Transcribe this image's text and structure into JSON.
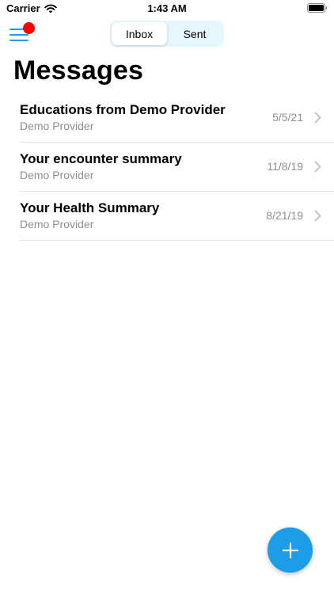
{
  "status_bar": {
    "carrier": "Carrier",
    "time": "1:43 AM"
  },
  "header": {
    "menu_icon": "hamburger-menu-icon",
    "has_notification": true,
    "tabs": [
      {
        "label": "Inbox",
        "selected": true
      },
      {
        "label": "Sent",
        "selected": false
      }
    ]
  },
  "page": {
    "title": "Messages"
  },
  "messages": [
    {
      "title": "Educations from Demo Provider",
      "sender": "Demo Provider",
      "date": "5/5/21"
    },
    {
      "title": "Your encounter summary",
      "sender": "Demo Provider",
      "date": "11/8/19"
    },
    {
      "title": "Your Health Summary",
      "sender": "Demo Provider",
      "date": "8/21/19"
    }
  ],
  "fab": {
    "icon": "plus-icon"
  },
  "colors": {
    "accent": "#1d9ce8",
    "notification": "#ff0000",
    "secondary_text": "#8e8e93",
    "segment_background": "#e6f6fd"
  }
}
